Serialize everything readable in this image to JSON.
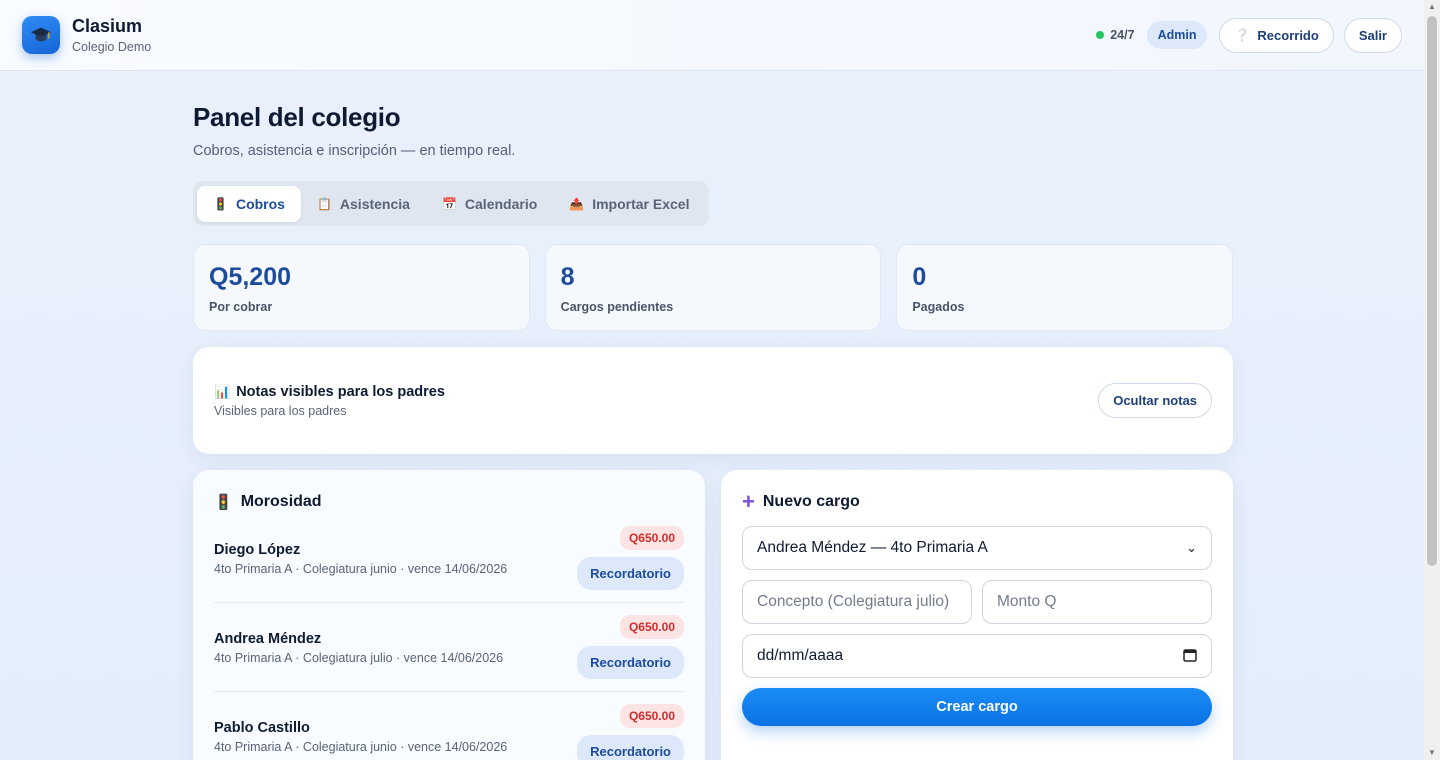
{
  "app": {
    "name": "Clasium",
    "school": "Colegio Demo"
  },
  "header": {
    "status": "24/7",
    "role_badge": "Admin",
    "tour_label": "Recorrido",
    "logout_label": "Salir",
    "status_color": "#22c55e"
  },
  "page": {
    "title": "Panel del colegio",
    "subtitle": "Cobros, asistencia e inscripción — en tiempo real."
  },
  "tabs": [
    {
      "label": "Cobros",
      "icon": "traffic-light-icon",
      "active": true
    },
    {
      "label": "Asistencia",
      "icon": "clipboard-icon",
      "active": false
    },
    {
      "label": "Calendario",
      "icon": "calendar-icon",
      "active": false
    },
    {
      "label": "Importar Excel",
      "icon": "upload-icon",
      "active": false
    }
  ],
  "stats": [
    {
      "value": "Q5,200",
      "label": "Por cobrar"
    },
    {
      "value": "8",
      "label": "Cargos pendientes"
    },
    {
      "value": "0",
      "label": "Pagados"
    }
  ],
  "notes": {
    "title": "Notas visibles para los padres",
    "subtitle": "Visibles para los padres",
    "button": "Ocultar notas",
    "icon": "bar-chart-icon"
  },
  "debts": {
    "title": "Morosidad",
    "icon": "traffic-light-icon",
    "items": [
      {
        "name": "Diego López",
        "meta": "4to Primaria A · Colegiatura junio · vence 14/06/2026",
        "amount": "Q650.00",
        "action": "Recordatorio"
      },
      {
        "name": "Andrea Méndez",
        "meta": "4to Primaria A · Colegiatura julio · vence 14/06/2026",
        "amount": "Q650.00",
        "action": "Recordatorio"
      },
      {
        "name": "Pablo Castillo",
        "meta": "4to Primaria A · Colegiatura junio · vence 14/06/2026",
        "amount": "Q650.00",
        "action": "Recordatorio"
      }
    ]
  },
  "new_charge": {
    "title": "Nuevo cargo",
    "icon": "plus-icon",
    "student_value": "Andrea Méndez — 4to Primaria A",
    "concept_placeholder": "Concepto (Colegiatura julio)",
    "amount_placeholder": "Monto Q",
    "date_placeholder": "dd/mm/aaaa",
    "submit": "Crear cargo"
  },
  "colors": {
    "accent": "#1d4c9c",
    "primary": "#0b72e6",
    "danger": "#d42c2c"
  }
}
